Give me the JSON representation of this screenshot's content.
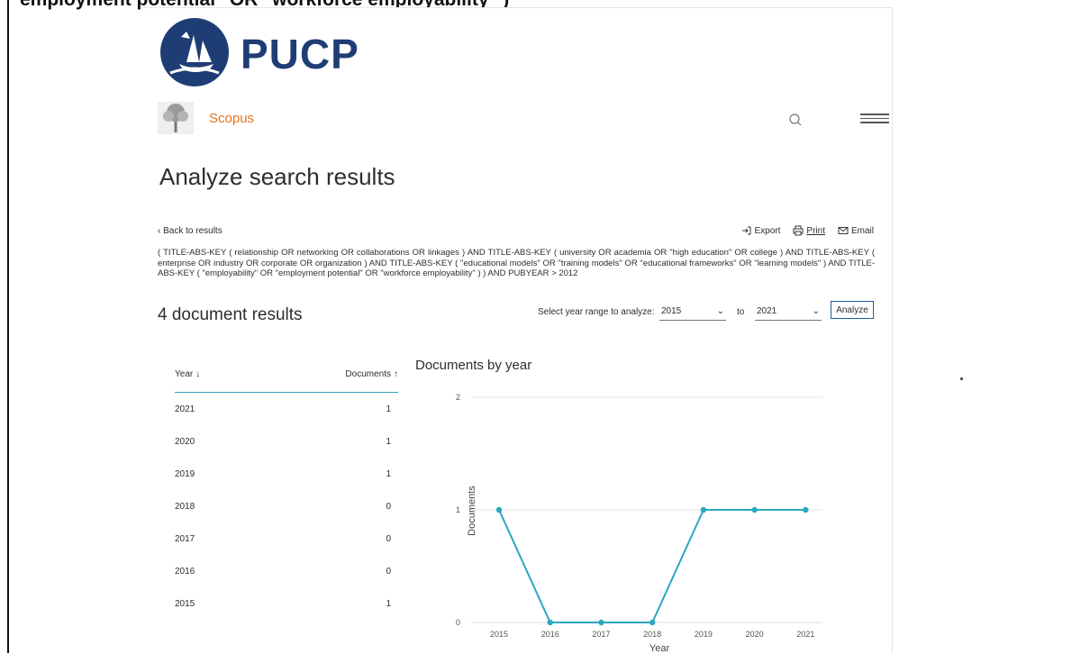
{
  "banner": {
    "text": "employment potential\" OR \"workforce employability\" )"
  },
  "brand": {
    "university": "PUCP",
    "product": "Scopus"
  },
  "page": {
    "title": "Analyze search results"
  },
  "nav": {
    "back": "Back to results"
  },
  "actions": {
    "export": "Export",
    "print": "Print",
    "email": "Email"
  },
  "query": "( TITLE-ABS-KEY ( relationship OR networking OR collaborations OR linkages ) AND TITLE-ABS-KEY ( university OR academia OR \"high education\" OR college ) AND TITLE-ABS-KEY ( enterprise OR industry OR corporate OR organization ) AND TITLE-ABS-KEY ( \"educational models\" OR \"training models\" OR \"educational frameworks\" OR \"learning models\" ) AND TITLE-ABS-KEY ( \"employability\" OR \"employment potential\" OR \"workforce employability\" ) ) AND PUBYEAR > 2012",
  "results": {
    "count_label": "4 document results"
  },
  "range": {
    "label": "Select year range to analyze:",
    "from": "2015",
    "to_label": "to",
    "to": "2021",
    "analyze": "Analyze"
  },
  "table": {
    "year_header": "Year",
    "docs_header": "Documents",
    "rows": [
      {
        "year": "2021",
        "count": "1"
      },
      {
        "year": "2020",
        "count": "1"
      },
      {
        "year": "2019",
        "count": "1"
      },
      {
        "year": "2018",
        "count": "0"
      },
      {
        "year": "2017",
        "count": "0"
      },
      {
        "year": "2016",
        "count": "0"
      },
      {
        "year": "2015",
        "count": "1"
      }
    ]
  },
  "chart_data": {
    "type": "line",
    "title": "Documents by year",
    "xlabel": "Year",
    "ylabel": "Documents",
    "x": [
      "2015",
      "2016",
      "2017",
      "2018",
      "2019",
      "2020",
      "2021"
    ],
    "values": [
      1,
      0,
      0,
      0,
      1,
      1,
      1
    ],
    "ylim": [
      0,
      2
    ],
    "yticks": [
      "0",
      "1",
      "2"
    ],
    "grid": true,
    "color": "#2aa7bf"
  },
  "colors": {
    "accent": "#2aa7bf",
    "scopus": "#e9711c",
    "pucp": "#1f3d75"
  }
}
